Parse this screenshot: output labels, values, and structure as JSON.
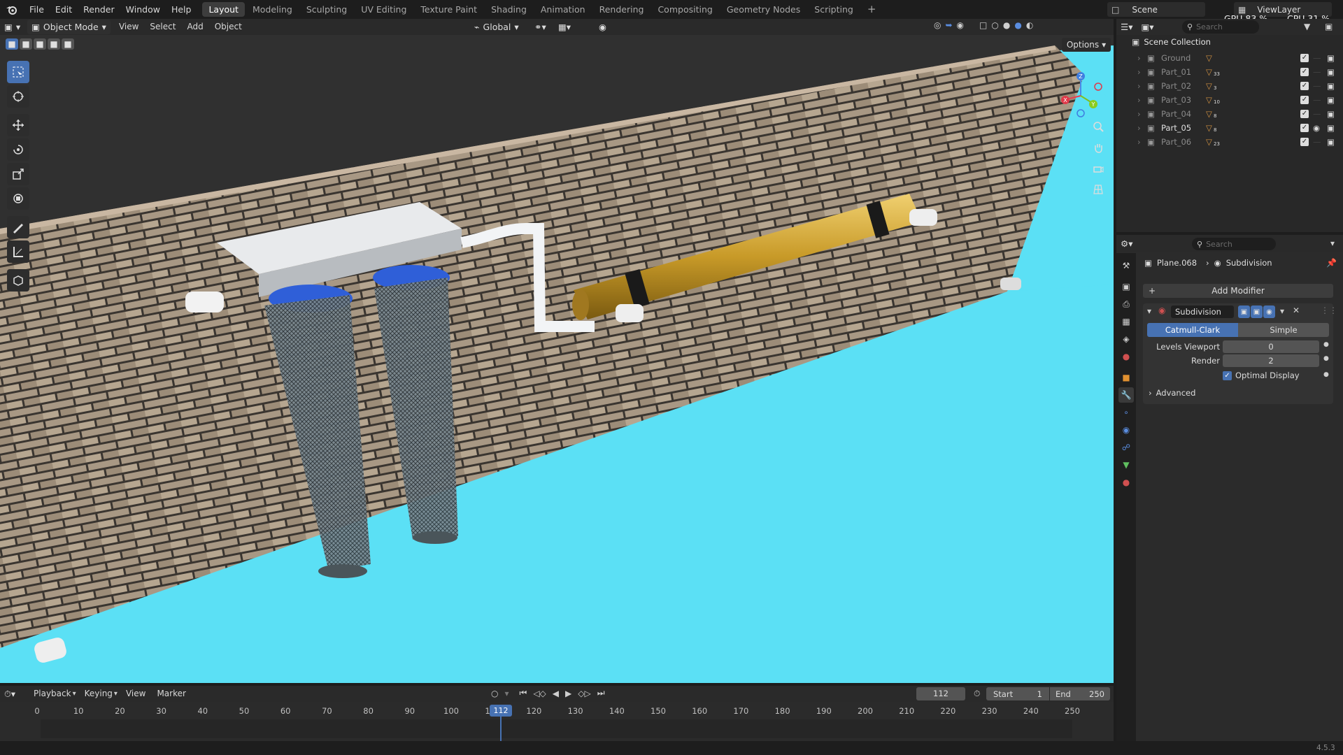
{
  "topbar": {
    "menus": [
      "File",
      "Edit",
      "Render",
      "Window",
      "Help"
    ],
    "workspaces": [
      "Layout",
      "Modeling",
      "Sculpting",
      "UV Editing",
      "Texture Paint",
      "Shading",
      "Animation",
      "Rendering",
      "Compositing",
      "Geometry Nodes",
      "Scripting"
    ],
    "active_workspace": "Layout",
    "add_tab": "+",
    "scene": "Scene",
    "view_layer": "ViewLayer",
    "gpu_label": "GPU",
    "gpu_value": "83 %",
    "cpu_label": "CPU",
    "cpu_value": "31 %"
  },
  "viewport_header": {
    "mode": "Object Mode",
    "menus": [
      "View",
      "Select",
      "Add",
      "Object"
    ],
    "orientation": "Global",
    "options": "Options"
  },
  "outliner": {
    "search_placeholder": "Search",
    "root": "Scene Collection",
    "items": [
      {
        "name": "Ground",
        "count": ""
      },
      {
        "name": "Part_01",
        "count": "33"
      },
      {
        "name": "Part_02",
        "count": "3"
      },
      {
        "name": "Part_03",
        "count": "10"
      },
      {
        "name": "Part_04",
        "count": "8"
      },
      {
        "name": "Part_05",
        "count": "8"
      },
      {
        "name": "Part_06",
        "count": "23"
      }
    ]
  },
  "properties": {
    "search_placeholder": "Search",
    "object": "Plane.068",
    "modifier_crumb": "Subdivision",
    "add_modifier": "Add Modifier",
    "modifier_name": "Subdivision",
    "algo_a": "Catmull-Clark",
    "algo_b": "Simple",
    "levels_label": "Levels Viewport",
    "levels_value": "0",
    "render_label": "Render",
    "render_value": "2",
    "optimal_label": "Optimal Display",
    "advanced_label": "Advanced"
  },
  "timeline": {
    "menus": [
      "Playback",
      "Keying",
      "View",
      "Marker"
    ],
    "current_frame": "112",
    "start_label": "Start",
    "start_value": "1",
    "end_label": "End",
    "end_value": "250",
    "ticks": [
      "0",
      "10",
      "20",
      "30",
      "40",
      "50",
      "60",
      "70",
      "80",
      "90",
      "100",
      "1",
      "120",
      "130",
      "140",
      "150",
      "160",
      "170",
      "180",
      "190",
      "200",
      "210",
      "220",
      "230",
      "240",
      "250"
    ],
    "playhead_label": "112"
  },
  "status": {
    "version": "4.5.3"
  },
  "colors": {
    "accent": "#4772b3",
    "ground": "#56d7f2",
    "brass": "#c8a030",
    "header": "#2a2a2a"
  }
}
